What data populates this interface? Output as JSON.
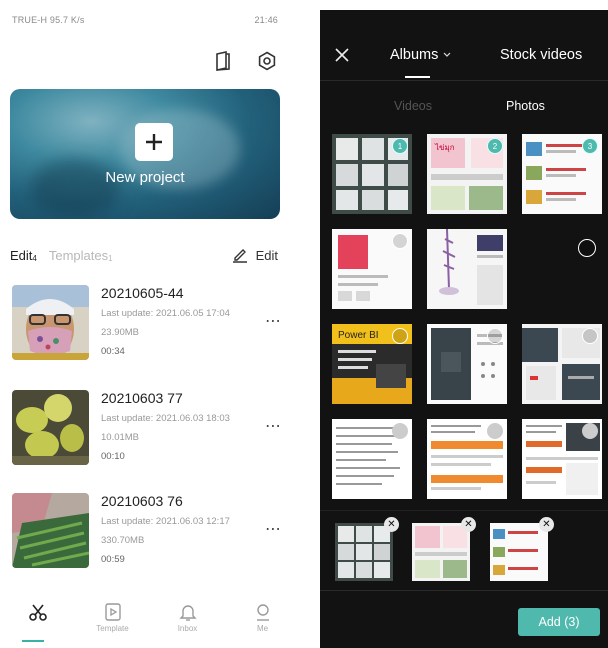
{
  "left": {
    "status": {
      "carrier": "TRUE-H",
      "speed": "95.7 K/s",
      "right": "21:46"
    },
    "new_project_label": "New project",
    "tabs": {
      "edit": "Edit",
      "edit_count": "4",
      "templates": "Templates",
      "templates_count": "1",
      "edit_action": "Edit"
    },
    "projects": [
      {
        "name": "20210605-44",
        "last_update": "Last update: 2021.06.05 17:04",
        "size": "23.90MB",
        "duration": "00:34"
      },
      {
        "name": "20210603 77",
        "last_update": "Last update: 2021.06.03 18:03",
        "size": "10.01MB",
        "duration": "00:10"
      },
      {
        "name": "20210603 76",
        "last_update": "Last update: 2021.06.03 12:17",
        "size": "330.70MB",
        "duration": "00:59"
      }
    ],
    "nav": [
      {
        "label": "",
        "icon": "scissors-icon"
      },
      {
        "label": "Template",
        "icon": "template-icon"
      },
      {
        "label": "Inbox",
        "icon": "bell-icon"
      },
      {
        "label": "Me",
        "icon": "person-icon"
      }
    ]
  },
  "right": {
    "albums": "Albums",
    "stock_videos": "Stock videos",
    "sub_tabs": {
      "videos": "Videos",
      "photos": "Photos"
    },
    "badges": [
      "1",
      "2",
      "3"
    ],
    "thumb_texts": {
      "powerbi": "Power BI"
    },
    "add_button": "Add (3)"
  },
  "colors": {
    "accent": "#4eb9ac",
    "dark_bg": "#121212"
  }
}
